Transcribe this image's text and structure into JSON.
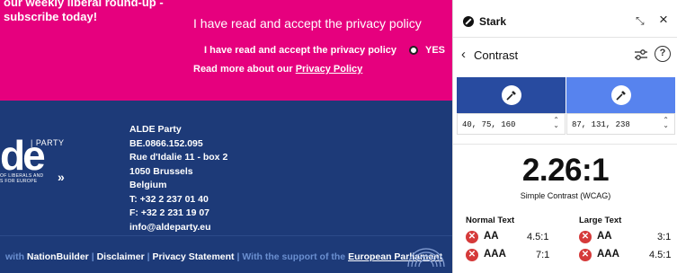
{
  "site": {
    "promo_line1": "our weekly liberal round-up -",
    "promo_line2": "subscribe today!",
    "privacy_heading": "I have read and accept the privacy policy",
    "privacy_check_label": "I have read and accept the privacy policy",
    "yes_label": "YES",
    "read_more_prefix": "Read more about our",
    "privacy_link": "Privacy Policy",
    "logo_text": "de",
    "logo_party": "| PARTY",
    "logo_sub1": "OF LIBERALS AND",
    "logo_sub2": "S FOR EUROPE",
    "address": [
      "ALDE Party",
      "BE.0866.152.095",
      "Rue d'Idalie 11 - box 2",
      "1050 Brussels",
      "Belgium",
      "T: +32 2 237 01 40",
      "F: +32 2 231 19 07",
      "info@aldeparty.eu"
    ],
    "footer": {
      "with": "with",
      "nationbuilder": "NationBuilder",
      "sep": "|",
      "disclaimer": "Disclaimer",
      "privacy_statement": "Privacy Statement",
      "support": "With the support of the",
      "ep": "European Parliament"
    },
    "colors": {
      "pink": "#e6007e",
      "navy": "#1d3a78"
    }
  },
  "panel": {
    "title": "Stark",
    "nav_title": "Contrast",
    "foreground_rgb": "40, 75, 160",
    "background_rgb": "87, 131, 238",
    "foreground_color": "#284ba0",
    "background_color": "#5783ee",
    "ratio": "2.26:1",
    "ratio_label": "Simple Contrast (WCAG)",
    "normal_text": {
      "heading": "Normal Text",
      "rows": [
        {
          "level": "AA",
          "required": "4.5:1",
          "status": "fail"
        },
        {
          "level": "AAA",
          "required": "7:1",
          "status": "fail"
        }
      ]
    },
    "large_text": {
      "heading": "Large Text",
      "rows": [
        {
          "level": "AA",
          "required": "3:1",
          "status": "fail"
        },
        {
          "level": "AAA",
          "required": "4.5:1",
          "status": "fail"
        }
      ]
    }
  }
}
